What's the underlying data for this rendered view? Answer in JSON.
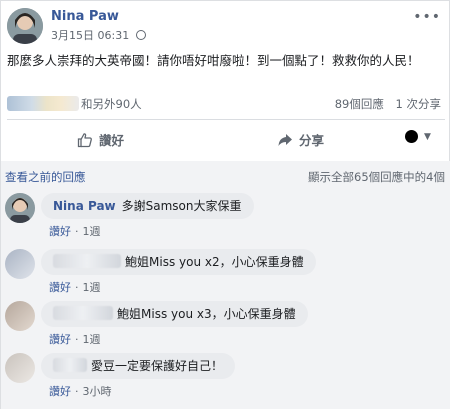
{
  "post": {
    "author": "Nina Paw",
    "timestamp": "3月15日 06:31",
    "more_label": "•••",
    "text": "那麼多人崇拜的大英帝國！請你唔好咁廢啦！到一個點了！救救你的人民！",
    "reactions_text": "和另外90人",
    "comments_count": "89個回應",
    "shares_count": "1 次分享",
    "actions": {
      "like": "讚好",
      "share": "分享"
    }
  },
  "comments_section": {
    "view_previous": "查看之前的回應",
    "count_text": "顯示全部65個回應中的4個",
    "comments": [
      {
        "name": "Nina Paw",
        "text": "多謝Samson大家保重",
        "like": "讚好",
        "time": "1週"
      },
      {
        "name": "",
        "text": "鮑姐Miss you x2，小心保重身體",
        "like": "讚好",
        "time": "1週"
      },
      {
        "name": "",
        "text": "鮑姐Miss you x3，小心保重身體",
        "like": "讚好",
        "time": "1週"
      },
      {
        "name": "",
        "text": "愛豆一定要保護好自己！",
        "like": "讚好",
        "time": "3小時"
      }
    ]
  },
  "colors": {
    "link": "#385898",
    "muted": "#606770",
    "bubble": "#e9ebee",
    "background": "#f2f3f5"
  }
}
